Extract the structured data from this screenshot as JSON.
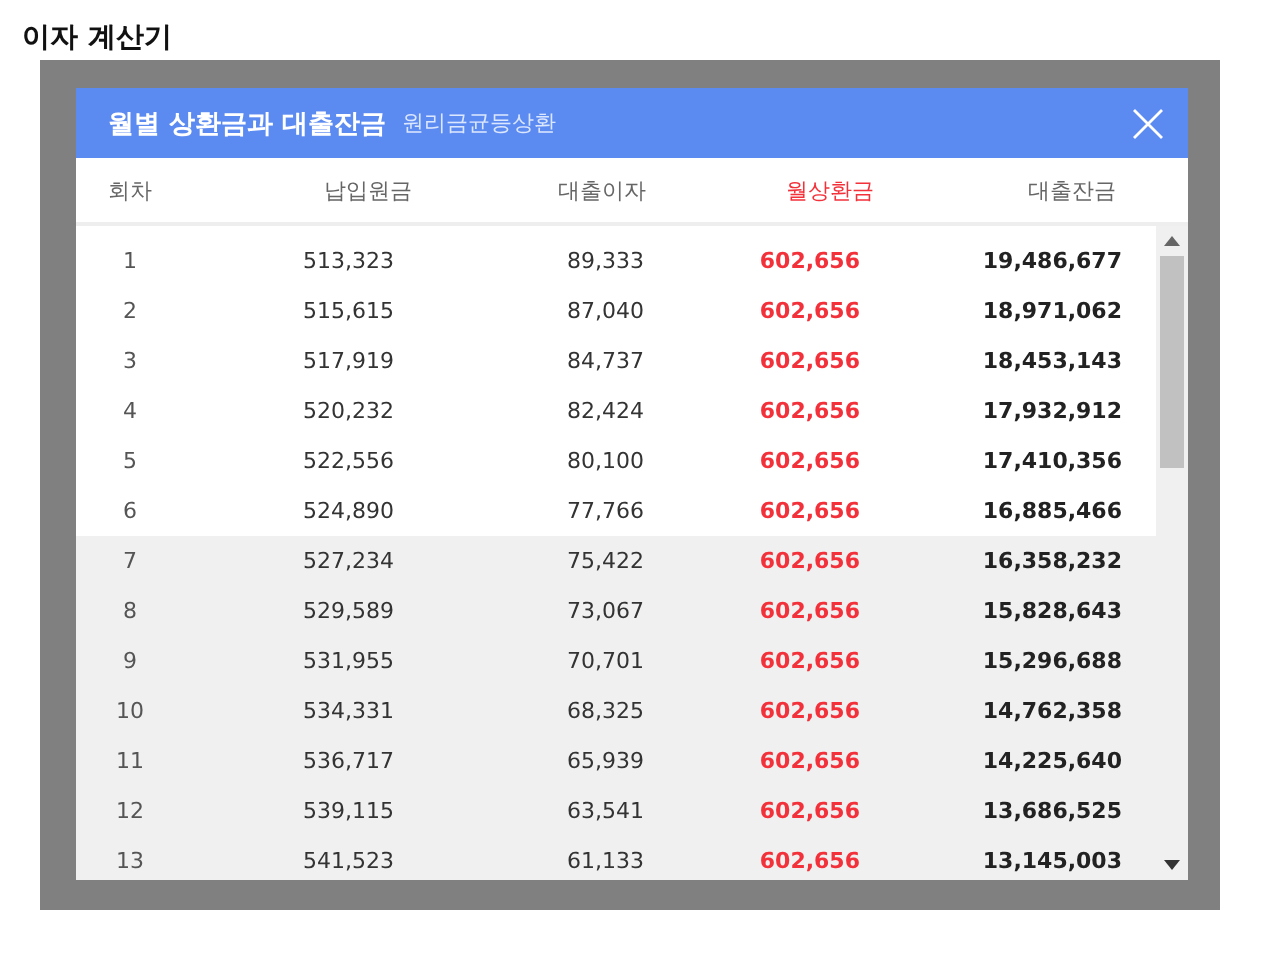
{
  "page_title": "이자 계산기",
  "modal": {
    "title": "월별 상환금과 대출잔금",
    "subtitle": "원리금균등상환",
    "columns": [
      "회차",
      "납입원금",
      "대출이자",
      "월상환금",
      "대출잔금"
    ],
    "rows": [
      {
        "cells": [
          "1",
          "513,323",
          "89,333",
          "602,656",
          "19,486,677"
        ],
        "shaded": false
      },
      {
        "cells": [
          "2",
          "515,615",
          "87,040",
          "602,656",
          "18,971,062"
        ],
        "shaded": false
      },
      {
        "cells": [
          "3",
          "517,919",
          "84,737",
          "602,656",
          "18,453,143"
        ],
        "shaded": false
      },
      {
        "cells": [
          "4",
          "520,232",
          "82,424",
          "602,656",
          "17,932,912"
        ],
        "shaded": false
      },
      {
        "cells": [
          "5",
          "522,556",
          "80,100",
          "602,656",
          "17,410,356"
        ],
        "shaded": false
      },
      {
        "cells": [
          "6",
          "524,890",
          "77,766",
          "602,656",
          "16,885,466"
        ],
        "shaded": false
      },
      {
        "cells": [
          "7",
          "527,234",
          "75,422",
          "602,656",
          "16,358,232"
        ],
        "shaded": true
      },
      {
        "cells": [
          "8",
          "529,589",
          "73,067",
          "602,656",
          "15,828,643"
        ],
        "shaded": true
      },
      {
        "cells": [
          "9",
          "531,955",
          "70,701",
          "602,656",
          "15,296,688"
        ],
        "shaded": true
      },
      {
        "cells": [
          "10",
          "534,331",
          "68,325",
          "602,656",
          "14,762,358"
        ],
        "shaded": true
      },
      {
        "cells": [
          "11",
          "536,717",
          "65,939",
          "602,656",
          "14,225,640"
        ],
        "shaded": true
      },
      {
        "cells": [
          "12",
          "539,115",
          "63,541",
          "602,656",
          "13,686,525"
        ],
        "shaded": true
      },
      {
        "cells": [
          "13",
          "541,523",
          "61,133",
          "602,656",
          "13,145,003"
        ],
        "shaded": true
      }
    ]
  }
}
